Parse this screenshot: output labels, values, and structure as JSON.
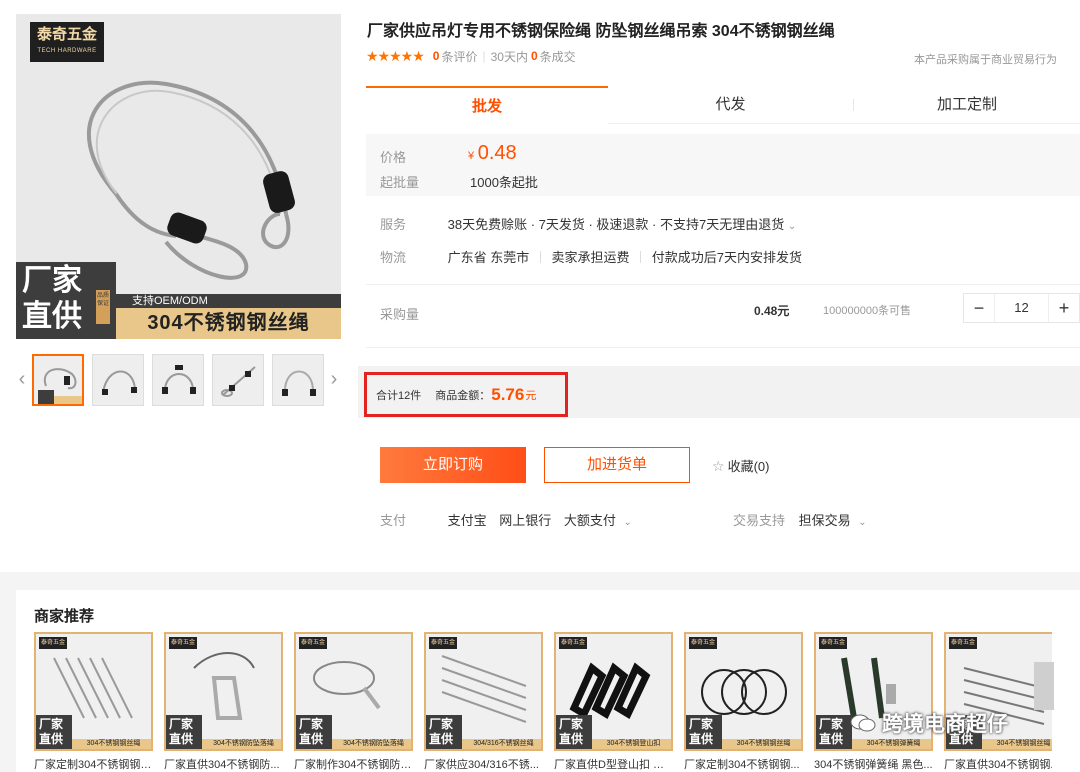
{
  "gallery": {
    "brand_cn": "泰奇五金",
    "brand_en": "TECH HARDWARE",
    "factory_line1": "厂家",
    "factory_line2": "直供",
    "seal_text": "品质保证",
    "oem_text": "支持OEM/ODM",
    "product_banner": "304不锈钢钢丝绳",
    "prev_arrow": "‹",
    "next_arrow": "›"
  },
  "product": {
    "title": "厂家供应吊灯专用不锈钢保险绳 防坠钢丝绳吊索 304不锈钢钢丝绳",
    "stars": "★★★★★",
    "review_count": "0",
    "review_label": "条评价",
    "deals_prefix": "30天内",
    "deals_count": "0",
    "deals_label": "条成交",
    "trade_note": "本产品采购属于商业贸易行为"
  },
  "tabs": [
    "批发",
    "代发",
    "加工定制"
  ],
  "price": {
    "label": "价格",
    "currency": "¥",
    "amount": "0.48",
    "moq_label": "起批量",
    "moq_value": "1000条起批"
  },
  "service": {
    "label": "服务",
    "value": "38天免费赊账 · 7天发货 · 极速退款 · 不支持7天无理由退货",
    "caret": "⌄"
  },
  "logistics": {
    "label": "物流",
    "origin": "广东省 东莞市",
    "shipping": "卖家承担运费",
    "delivery": "付款成功后7天内安排发货"
  },
  "quantity": {
    "label": "采购量",
    "unit_price": "0.48元",
    "stock": "100000000条可售",
    "minus": "−",
    "value": "12",
    "plus": "+"
  },
  "total": {
    "count_text": "合计12件",
    "amount_label": "商品金额：",
    "amount": "5.76",
    "unit": "元",
    "highlight_color": "#e52222"
  },
  "actions": {
    "buy": "立即订购",
    "cart": "加进货单",
    "favorite_icon": "☆",
    "favorite": "收藏(0)"
  },
  "payment": {
    "label": "支付",
    "methods": [
      "支付宝",
      "网上银行",
      "大额支付"
    ],
    "caret": "⌄",
    "support_label": "交易支持",
    "support_value": "担保交易"
  },
  "recommend": {
    "title": "商家推荐",
    "logo": "泰奇五金",
    "factory": "厂家直供",
    "items": [
      {
        "caption": "厂家定制304不锈钢钢丝...",
        "stripe": "304不锈钢钢丝绳"
      },
      {
        "caption": "厂家直供304不锈钢防...",
        "stripe": "304不锈钢防坠落绳"
      },
      {
        "caption": "厂家制作304不锈钢防坠...",
        "stripe": "304不锈钢防坠落绳"
      },
      {
        "caption": "厂家供应304/316不锈...",
        "stripe": "304/316不锈钢丝绳"
      },
      {
        "caption": "厂家直供D型登山扣 户...",
        "stripe": "304不锈钢登山扣"
      },
      {
        "caption": "厂家定制304不锈钢钢...",
        "stripe": "304不锈钢钢丝绳"
      },
      {
        "caption": "304不锈钢弹簧绳 黑色...",
        "stripe": "304不锈钢弹簧绳"
      },
      {
        "caption": "厂家直供304不锈钢钢...",
        "stripe": "304不锈钢钢丝绳"
      }
    ]
  },
  "watermark": "跨境电商超仔",
  "accent_color": "#ff5000"
}
